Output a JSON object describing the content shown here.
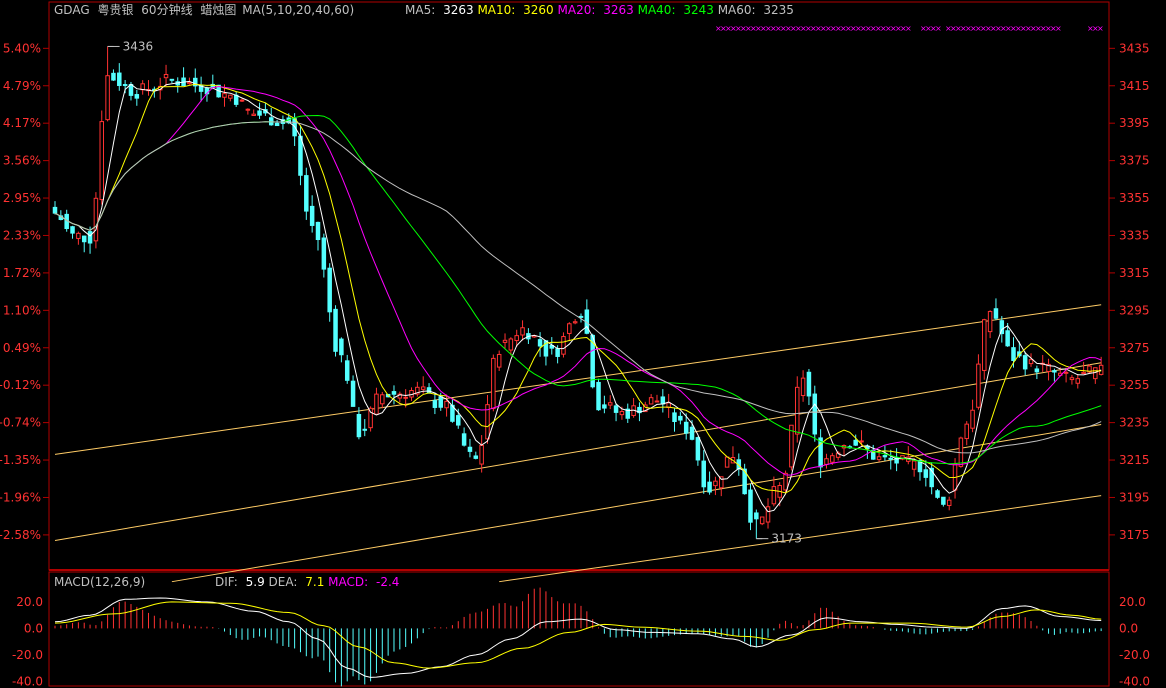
{
  "header": {
    "symbol": "GDAG",
    "name": "粤贵银",
    "period": "60分钟线",
    "chart_kind": "蜡烛图",
    "ma_spec": "MA(5,10,20,40,60)",
    "ma": [
      {
        "label": "MA5:",
        "value": "3263",
        "color": "#ffffff"
      },
      {
        "label": "MA10:",
        "value": "3260",
        "color": "#ffff00"
      },
      {
        "label": "MA20:",
        "value": "3263",
        "color": "#ff00ff"
      },
      {
        "label": "MA40:",
        "value": "3243",
        "color": "#00ff00"
      },
      {
        "label": "MA60:",
        "value": "3235",
        "color": "#c0c0c0"
      }
    ]
  },
  "macd_header": {
    "title": "MACD(12,26,9)",
    "dif_label": "DIF:",
    "dif": "5.9",
    "dea_label": "DEA:",
    "dea": "7.1",
    "macd_label": "MACD:",
    "macd": "-2.4"
  },
  "colors": {
    "up": "#ff3232",
    "down": "#54ffff",
    "frame": "#b00000",
    "axis_text": "#ff3232",
    "text": "#c0c0c0"
  },
  "chart_data": [
    {
      "type": "candlestick",
      "title": "GDAG 粤贵银 60分钟线 蜡烛图",
      "ylim": [
        3168,
        3448
      ],
      "price_ticks": [
        3435,
        3415,
        3395,
        3375,
        3355,
        3335,
        3315,
        3295,
        3275,
        3255,
        3235,
        3215,
        3195,
        3175
      ],
      "percent_ticks": [
        "5.40%",
        "4.79%",
        "4.17%",
        "3.56%",
        "2.95%",
        "2.33%",
        "1.72%",
        "1.10%",
        "0.49%",
        "-0.12%",
        "-0.74%",
        "-1.35%",
        "-1.96%",
        "-2.58%"
      ],
      "annotations": [
        {
          "text": "3436",
          "bar": 9,
          "price": 3436,
          "side": "high"
        },
        {
          "text": "3173",
          "bar": 120,
          "price": 3173,
          "side": "low"
        }
      ],
      "ohlc_anchors": [
        {
          "bar": 0,
          "close": 3347
        },
        {
          "bar": 3,
          "close": 3335
        },
        {
          "bar": 6,
          "close": 3334
        },
        {
          "bar": 9,
          "close": 3420
        },
        {
          "bar": 14,
          "close": 3412
        },
        {
          "bar": 20,
          "close": 3418
        },
        {
          "bar": 25,
          "close": 3415
        },
        {
          "bar": 30,
          "close": 3410
        },
        {
          "bar": 34,
          "close": 3400
        },
        {
          "bar": 40,
          "close": 3395
        },
        {
          "bar": 44,
          "close": 3340
        },
        {
          "bar": 49,
          "close": 3270
        },
        {
          "bar": 52,
          "close": 3230
        },
        {
          "bar": 56,
          "close": 3250
        },
        {
          "bar": 62,
          "close": 3252
        },
        {
          "bar": 66,
          "close": 3245
        },
        {
          "bar": 72,
          "close": 3215
        },
        {
          "bar": 76,
          "close": 3275
        },
        {
          "bar": 80,
          "close": 3285
        },
        {
          "bar": 85,
          "close": 3272
        },
        {
          "bar": 90,
          "close": 3295
        },
        {
          "bar": 93,
          "close": 3245
        },
        {
          "bar": 97,
          "close": 3240
        },
        {
          "bar": 103,
          "close": 3247
        },
        {
          "bar": 108,
          "close": 3232
        },
        {
          "bar": 112,
          "close": 3200
        },
        {
          "bar": 116,
          "close": 3218
        },
        {
          "bar": 120,
          "close": 3180
        },
        {
          "bar": 124,
          "close": 3200
        },
        {
          "bar": 128,
          "close": 3260
        },
        {
          "bar": 131,
          "close": 3215
        },
        {
          "bar": 136,
          "close": 3225
        },
        {
          "bar": 142,
          "close": 3215
        },
        {
          "bar": 148,
          "close": 3212
        },
        {
          "bar": 152,
          "close": 3190
        },
        {
          "bar": 156,
          "close": 3235
        },
        {
          "bar": 160,
          "close": 3295
        },
        {
          "bar": 164,
          "close": 3270
        },
        {
          "bar": 168,
          "close": 3265
        },
        {
          "bar": 174,
          "close": 3258
        },
        {
          "bar": 178,
          "close": 3262
        }
      ],
      "bar_count": 180,
      "ma_series": [
        "MA5",
        "MA10",
        "MA20",
        "MA40",
        "MA60"
      ],
      "trendlines": [
        {
          "p1": {
            "bar": 0,
            "price": 3172
          },
          "p2": {
            "bar": 179,
            "price": 3267
          }
        },
        {
          "p1": {
            "bar": 0,
            "price": 3218
          },
          "p2": {
            "bar": 179,
            "price": 3298
          }
        },
        {
          "p1": {
            "bar": 20,
            "price": 3150
          },
          "p2": {
            "bar": 179,
            "price": 3234
          }
        },
        {
          "p1": {
            "bar": 76,
            "price": 3150
          },
          "p2": {
            "bar": 179,
            "price": 3196
          }
        }
      ]
    },
    {
      "type": "macd",
      "title": "MACD(12,26,9)",
      "ylim": [
        -42,
        26
      ],
      "ticks": [
        "20.0",
        "0.0",
        "-20.0",
        "-40.0"
      ],
      "tick_values": [
        20,
        0,
        -20,
        -40
      ],
      "dif_anchors": [
        {
          "bar": 0,
          "v": 5
        },
        {
          "bar": 6,
          "v": 10
        },
        {
          "bar": 12,
          "v": 22
        },
        {
          "bar": 18,
          "v": 23
        },
        {
          "bar": 26,
          "v": 20
        },
        {
          "bar": 34,
          "v": 13
        },
        {
          "bar": 40,
          "v": 5
        },
        {
          "bar": 45,
          "v": -8
        },
        {
          "bar": 50,
          "v": -30
        },
        {
          "bar": 54,
          "v": -37
        },
        {
          "bar": 60,
          "v": -34
        },
        {
          "bar": 66,
          "v": -29
        },
        {
          "bar": 72,
          "v": -20
        },
        {
          "bar": 78,
          "v": -8
        },
        {
          "bar": 84,
          "v": 5
        },
        {
          "bar": 90,
          "v": 7
        },
        {
          "bar": 96,
          "v": -1
        },
        {
          "bar": 102,
          "v": -3
        },
        {
          "bar": 110,
          "v": -4
        },
        {
          "bar": 116,
          "v": -8
        },
        {
          "bar": 120,
          "v": -14
        },
        {
          "bar": 126,
          "v": -5
        },
        {
          "bar": 132,
          "v": 8
        },
        {
          "bar": 138,
          "v": 5
        },
        {
          "bar": 144,
          "v": 3
        },
        {
          "bar": 150,
          "v": 1
        },
        {
          "bar": 156,
          "v": 0
        },
        {
          "bar": 162,
          "v": 15
        },
        {
          "bar": 166,
          "v": 17
        },
        {
          "bar": 172,
          "v": 9
        },
        {
          "bar": 179,
          "v": 6
        }
      ],
      "dea_anchors": [
        {
          "bar": 0,
          "v": 4
        },
        {
          "bar": 10,
          "v": 11
        },
        {
          "bar": 20,
          "v": 20
        },
        {
          "bar": 30,
          "v": 19
        },
        {
          "bar": 40,
          "v": 12
        },
        {
          "bar": 46,
          "v": 2
        },
        {
          "bar": 52,
          "v": -14
        },
        {
          "bar": 58,
          "v": -26
        },
        {
          "bar": 64,
          "v": -30
        },
        {
          "bar": 72,
          "v": -26
        },
        {
          "bar": 80,
          "v": -15
        },
        {
          "bar": 88,
          "v": -3
        },
        {
          "bar": 94,
          "v": 3
        },
        {
          "bar": 100,
          "v": 1
        },
        {
          "bar": 110,
          "v": -2
        },
        {
          "bar": 118,
          "v": -6
        },
        {
          "bar": 124,
          "v": -9
        },
        {
          "bar": 130,
          "v": -1
        },
        {
          "bar": 136,
          "v": 4
        },
        {
          "bar": 146,
          "v": 4
        },
        {
          "bar": 156,
          "v": 1
        },
        {
          "bar": 162,
          "v": 9
        },
        {
          "bar": 168,
          "v": 14
        },
        {
          "bar": 174,
          "v": 10
        },
        {
          "bar": 179,
          "v": 7
        }
      ]
    }
  ]
}
